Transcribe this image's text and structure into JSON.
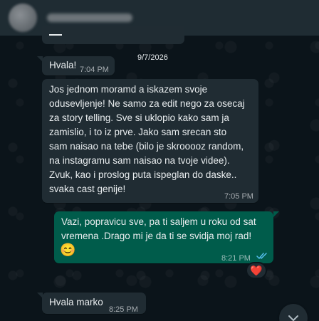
{
  "header": {
    "contact_avatar": "avatar",
    "contact_name": ""
  },
  "chat": {
    "date_label": "9/7/2026",
    "messages": [
      {
        "direction": "incoming",
        "text": "Hvala!",
        "time": "7:04 PM"
      },
      {
        "direction": "incoming",
        "text": "Jos jednom moramd a iskazem svoje\nodusevljenje! Ne samo za edit nego za osecaj\nza story telling. Sve si uklopio kako sam ja\nzamislio, i to iz prve. Jako sam srecan sto\nsam naisao na tebe (bilo je skrooooz random,\nna instagramu sam naisao na tvoje videe).\nZvuk, kao i proslog puta ispeglan do daske..\nsvaka cast genije!",
        "time": "7:05 PM"
      },
      {
        "direction": "outgoing",
        "text": "Vazi, popravicu sve, pa ti saljem u roku od sat\nvremena .Drago mi je da ti se svidja moj rad!",
        "emoji": "😊",
        "time": "8:21 PM",
        "status": "read",
        "reaction": "❤️"
      },
      {
        "direction": "incoming",
        "text": "Hvala marko",
        "time": "8:25 PM"
      }
    ]
  },
  "icons": {
    "read_ticks": "double-check-icon",
    "scroll_down": "chevron-down-icon"
  },
  "colors": {
    "background": "#0b141a",
    "incoming_bubble": "#202c33",
    "outgoing_bubble": "#005c4b",
    "read_ticks": "#53bdeb"
  }
}
